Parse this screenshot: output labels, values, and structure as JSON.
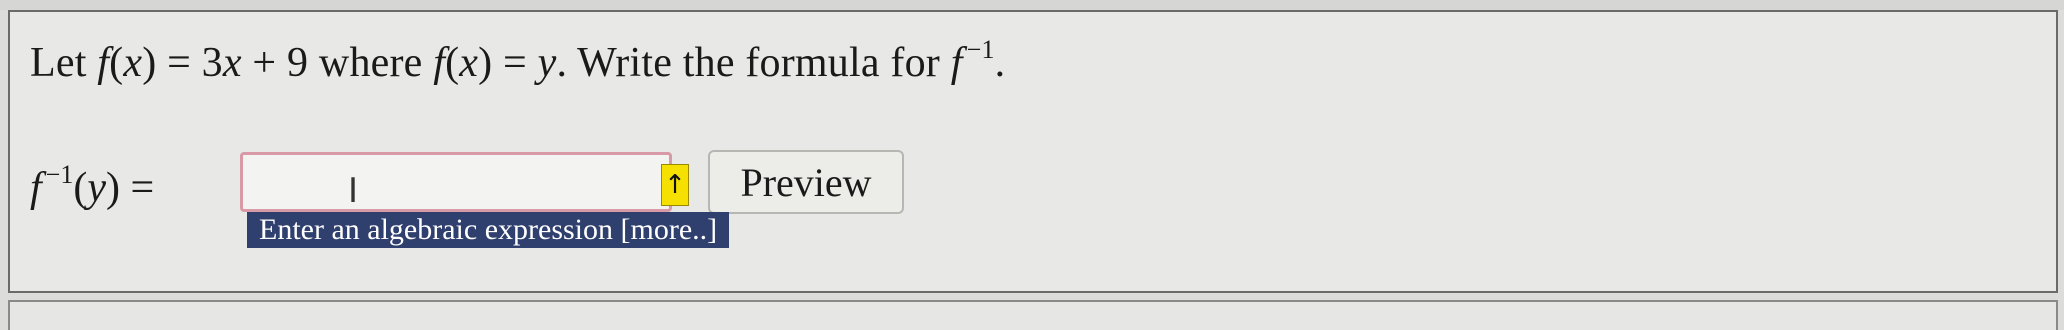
{
  "problem": {
    "prefix": "Let",
    "f": "f",
    "lparen": "(",
    "x": "x",
    "rparen": ")",
    "eq": "=",
    "rhs_coef": "3",
    "rhs_var": "x",
    "plus": "+",
    "rhs_const": "9",
    "where": "where",
    "eq2": "=",
    "y": "y",
    "period1": ".",
    "instruction": "Write the formula for",
    "inv_f": "f",
    "inv_exp": "−1",
    "period2": "."
  },
  "answer": {
    "f": "f",
    "inv_exp": "−1",
    "lparen": "(",
    "y": "y",
    "rparen": ")",
    "eq": "=",
    "input_value": "",
    "arrow": "↑",
    "preview_label": "Preview",
    "tooltip": "Enter an algebraic expression [more..]"
  },
  "colors": {
    "tooltip_bg": "#2f3f6e",
    "arrow_bg": "#f5e000",
    "input_border": "#d79aa6"
  },
  "icons": {
    "cursor": "text-cursor-icon",
    "arrow": "up-arrow-icon"
  }
}
